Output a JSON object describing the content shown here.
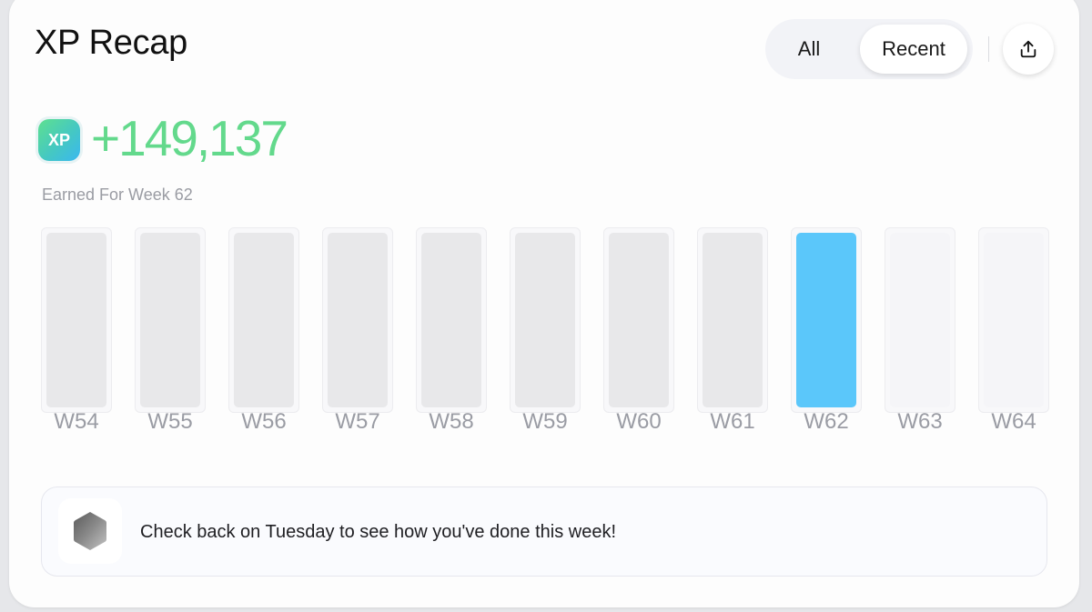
{
  "header": {
    "title": "XP Recap",
    "filter": {
      "options": [
        "All",
        "Recent"
      ],
      "selected": "Recent"
    },
    "share_icon": "share-upload-icon"
  },
  "summary": {
    "badge_label": "XP",
    "value": "+149,137",
    "caption": "Earned For Week 62"
  },
  "weeks": [
    {
      "label": "W54",
      "state": "past",
      "fill": 1.0
    },
    {
      "label": "W55",
      "state": "past",
      "fill": 1.0
    },
    {
      "label": "W56",
      "state": "past",
      "fill": 1.0
    },
    {
      "label": "W57",
      "state": "past",
      "fill": 1.0
    },
    {
      "label": "W58",
      "state": "past",
      "fill": 1.0
    },
    {
      "label": "W59",
      "state": "past",
      "fill": 1.0
    },
    {
      "label": "W60",
      "state": "past",
      "fill": 1.0
    },
    {
      "label": "W61",
      "state": "past",
      "fill": 1.0
    },
    {
      "label": "W62",
      "state": "current",
      "fill": 1.0
    },
    {
      "label": "W63",
      "state": "future",
      "fill": 1.0
    },
    {
      "label": "W64",
      "state": "future",
      "fill": 1.0
    }
  ],
  "notice": {
    "icon": "hexagon-icon",
    "text": "Check back on Tuesday to see how you've done this week!"
  },
  "colors": {
    "accent_green": "#63d98c",
    "current_bar": "#5bc7fa",
    "past_bar": "#e8e8ea",
    "future_bar": "#f5f5f8"
  }
}
